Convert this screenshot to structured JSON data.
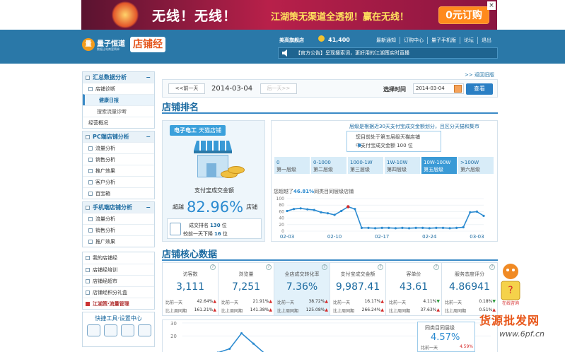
{
  "banner": {
    "headline": "无线！无线！",
    "tagline": "江湖策无渠道全透视！赢在无线！",
    "button": "0元订购",
    "close": "×"
  },
  "header": {
    "logo_text": "量子恒道",
    "logo_sub": "数据让电商更简单",
    "logo_badge": "店铺经",
    "shop_name": "美高旗舰店",
    "coins": "41,400",
    "nav": [
      "最新通知",
      "订购中心",
      "量子手机版",
      "论坛",
      "退出"
    ],
    "notice": "【官方公告】呈现搜索词，更好用的江湖策实时直播"
  },
  "back_link": ">> 返回旧版",
  "sidebar": {
    "sections": [
      {
        "title": "汇总数据分析",
        "items": [
          {
            "label": "店铺诊断",
            "type": "item"
          },
          {
            "label": "健康日报",
            "type": "sub",
            "active": true
          },
          {
            "label": "搜索流量诊断",
            "type": "sub"
          },
          {
            "label": "经营概况",
            "type": "item"
          }
        ]
      },
      {
        "title": "PC端店铺分析",
        "items": [
          {
            "label": "流量分析",
            "type": "item"
          },
          {
            "label": "销售分析",
            "type": "item"
          },
          {
            "label": "推广效果",
            "type": "item"
          },
          {
            "label": "客户分析",
            "type": "item"
          },
          {
            "label": "百宝箱",
            "type": "item"
          }
        ]
      },
      {
        "title": "手机端店铺分析",
        "items": [
          {
            "label": "流量分析",
            "type": "item"
          },
          {
            "label": "销售分析",
            "type": "item"
          },
          {
            "label": "推广效果",
            "type": "item"
          }
        ]
      }
    ],
    "bottom": [
      "我的店铺经",
      "店铺经培训",
      "店铺经超市",
      "店铺经积分礼盒",
      "江湖策·流量管理"
    ],
    "tools_title": "快捷工具·设置中心"
  },
  "datebar": {
    "prev": "<<前一天",
    "date": "2014-03-04",
    "next": "后一天>>",
    "select_label": "选择时间",
    "select_value": "2014-03-04",
    "query": "查看"
  },
  "rank": {
    "title": "店铺排名",
    "shop_chip_a": "电子电工",
    "shop_chip_b": "天猫店铺",
    "pay_label": "支付宝成交金额",
    "exceed_pre": "超越",
    "exceed_value": "82.96%",
    "exceed_post": "店铺",
    "rank_line_pre": "成交排名",
    "rank_value": "130",
    "rank_line_post": "位",
    "rank_change_pre": "较前一天下降",
    "rank_change": "16",
    "rank_change_post": "位",
    "tier_note": "层级是根据近30天支付宝成交金额划分，且区分天猫和集市",
    "tip_line1": "您目前处于第五层级天猫店铺",
    "tip_line2": "中支付宝成交金额 100 位",
    "tiers": [
      {
        "range": "0",
        "name": "第一层级"
      },
      {
        "range": "0-1000",
        "name": "第二层级"
      },
      {
        "range": "1000-1W",
        "name": "第三层级"
      },
      {
        "range": "1W-10W",
        "name": "第四层级"
      },
      {
        "range": "10W-100W",
        "name": "第五层级",
        "active": true
      },
      {
        "range": ">100W",
        "name": "第六层级"
      }
    ],
    "trend_label_pre": "您超越了",
    "trend_value": "46.81%",
    "trend_label_post": "同类目同层级店铺"
  },
  "chart_data": [
    {
      "type": "line",
      "title": "",
      "ylim": [
        0,
        100
      ],
      "yticks": [
        0,
        20,
        40,
        60,
        80,
        100
      ],
      "x": [
        "02-03",
        "02-04",
        "02-05",
        "02-06",
        "02-07",
        "02-08",
        "02-09",
        "02-10",
        "02-11",
        "02-12",
        "02-13",
        "02-14",
        "02-15",
        "02-16",
        "02-17",
        "02-18",
        "02-19",
        "02-20",
        "02-21",
        "02-22",
        "02-23",
        "02-24",
        "02-25",
        "02-26",
        "02-27",
        "02-28",
        "03-01",
        "03-02",
        "03-03",
        "03-04"
      ],
      "xticks": [
        "02-03",
        "02-10",
        "02-17",
        "02-24",
        "03-03"
      ],
      "series": [
        {
          "values": [
            62,
            68,
            70,
            67,
            65,
            58,
            55,
            50,
            62,
            75,
            68,
            10,
            10,
            9,
            10,
            10,
            9,
            10,
            9,
            10,
            10,
            9,
            10,
            10,
            9,
            10,
            12,
            58,
            60,
            47
          ]
        }
      ],
      "color": "#2a8ad0"
    },
    {
      "type": "line",
      "ylim": [
        0,
        30
      ],
      "yticks": [
        20,
        30
      ],
      "series": [
        {
          "values": [
            5,
            6,
            4,
            7,
            10,
            22,
            14,
            6,
            5,
            4,
            3,
            4,
            5,
            6,
            5,
            4,
            3,
            5,
            4,
            3
          ]
        }
      ],
      "color": "#2a8ad0"
    }
  ],
  "core": {
    "title": "店铺核心数据",
    "prev_label": "比前一天",
    "week_label": "比上周同期",
    "tiles": [
      {
        "label": "访客数",
        "value": "3,111",
        "d1": "42.64%",
        "d1dir": "up",
        "d2": "161.21%",
        "d2dir": "up"
      },
      {
        "label": "浏览量",
        "value": "7,251",
        "d1": "21.91%",
        "d1dir": "up",
        "d2": "141.38%",
        "d2dir": "up"
      },
      {
        "label": "全店成交转化率",
        "value": "7.36%",
        "d1": "38.72%",
        "d1dir": "up",
        "d2": "125.08%",
        "d2dir": "up",
        "hl": true
      },
      {
        "label": "支付宝成交金额",
        "value": "9,987.41",
        "d1": "16.17%",
        "d1dir": "up",
        "d2": "266.24%",
        "d2dir": "up"
      },
      {
        "label": "客单价",
        "value": "43.61",
        "d1": "4.11%",
        "d1dir": "dn",
        "d2": "37.63%",
        "d2dir": "up"
      },
      {
        "label": "服务态度评分",
        "value": "4.86941",
        "d1": "0.18%",
        "d1dir": "dn",
        "d2": "0.51%",
        "d2dir": "up"
      }
    ]
  },
  "conv_box": {
    "label": "同类目同层级",
    "value": "4.57%",
    "row_label": "比前一天",
    "row_value": "4.59%"
  },
  "watermark": {
    "line1": "货源批发网",
    "line2": "www.6pf.cn"
  },
  "mascot_label": "在线咨询",
  "colors": {
    "accent": "#2a78a8",
    "up": "#d52b2b",
    "down": "#2a9a3a"
  }
}
